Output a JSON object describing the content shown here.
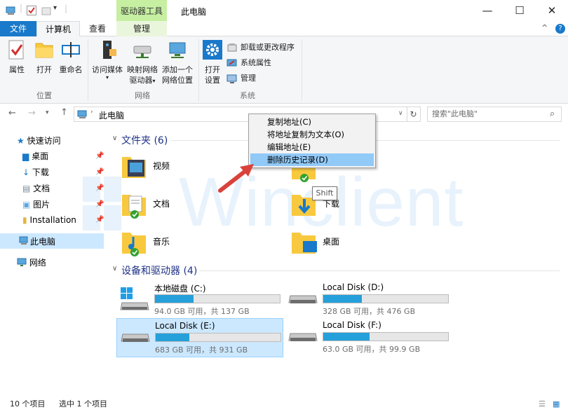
{
  "titlebar": {
    "context_tab": "驱动器工具",
    "title": "此电脑",
    "minimize": "—",
    "maximize": "☐",
    "close": "✕"
  },
  "tabs": {
    "file": "文件",
    "computer": "计算机",
    "view": "查看",
    "manage": "管理",
    "collapse": "^",
    "help": "?"
  },
  "ribbon": {
    "location": {
      "properties": "属性",
      "open": "打开",
      "rename": "重命名",
      "label": "位置"
    },
    "network": {
      "access_media_1": "访问媒体",
      "map_drive_1": "映射网络",
      "map_drive_2": "驱动器",
      "add_location_1": "添加一个",
      "add_location_2": "网络位置",
      "label": "网络"
    },
    "system": {
      "open_settings_1": "打开",
      "open_settings_2": "设置",
      "uninstall": "卸载或更改程序",
      "sys_props": "系统属性",
      "manage": "管理",
      "label": "系统"
    }
  },
  "address": {
    "path": "此电脑",
    "search_placeholder": "搜索\"此电脑\""
  },
  "nav": {
    "quick_access": "快速访问",
    "items": [
      "桌面",
      "下载",
      "文档",
      "图片",
      "Installation"
    ],
    "this_pc": "此电脑",
    "network": "网络"
  },
  "folders": {
    "header": "文件夹 (6)",
    "items": [
      "视频",
      "文档",
      "音乐",
      "下载",
      "桌面"
    ]
  },
  "drives": {
    "header": "设备和驱动器 (4)",
    "items": [
      {
        "name": "本地磁盘 (C:)",
        "cap": "94.0 GB 可用，共 137 GB",
        "used": 0.31
      },
      {
        "name": "Local Disk (D:)",
        "cap": "328 GB 可用，共 476 GB",
        "used": 0.31
      },
      {
        "name": "Local Disk (E:)",
        "cap": "683 GB 可用，共 931 GB",
        "used": 0.27
      },
      {
        "name": "Local Disk (F:)",
        "cap": "63.0 GB 可用，共 99.9 GB",
        "used": 0.37
      }
    ]
  },
  "context_menu": {
    "items": [
      "复制地址(C)",
      "将地址复制为文本(O)",
      "编辑地址(E)",
      "删除历史记录(D)"
    ]
  },
  "tooltip": "Shift",
  "watermark": "Winclient",
  "status": {
    "count": "10 个项目",
    "selected": "选中 1 个项目"
  }
}
